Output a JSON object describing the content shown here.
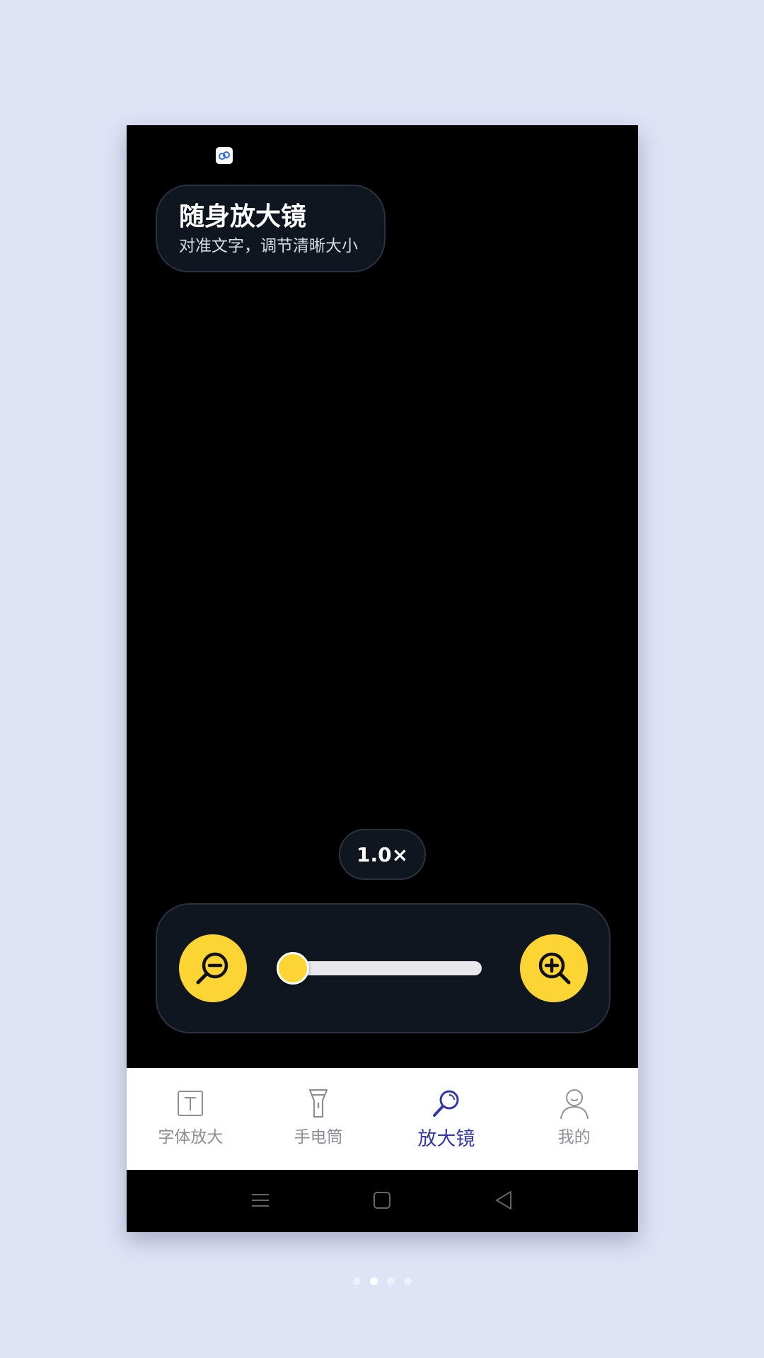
{
  "header": {
    "title": "随身放大镜",
    "subtitle": "对准文字，调节清晰大小"
  },
  "zoom": {
    "label": "1.0×",
    "slider_level": 0.0
  },
  "controls": {
    "zoom_out_icon": "zoom-out-icon",
    "zoom_in_icon": "zoom-in-icon"
  },
  "tabs": [
    {
      "label": "字体放大",
      "icon": "text-icon",
      "active": false
    },
    {
      "label": "手电筒",
      "icon": "flashlight-icon",
      "active": false
    },
    {
      "label": "放大镜",
      "icon": "magnifier-icon",
      "active": true
    },
    {
      "label": "我的",
      "icon": "user-icon",
      "active": false
    }
  ],
  "colors": {
    "accent": "#fcd535",
    "active_tab": "#3438a6",
    "inactive_tab": "#8d8f96",
    "panel": "#10161f",
    "background": "#dfe3f6"
  },
  "pager": {
    "count": 4,
    "active_index": 1
  }
}
